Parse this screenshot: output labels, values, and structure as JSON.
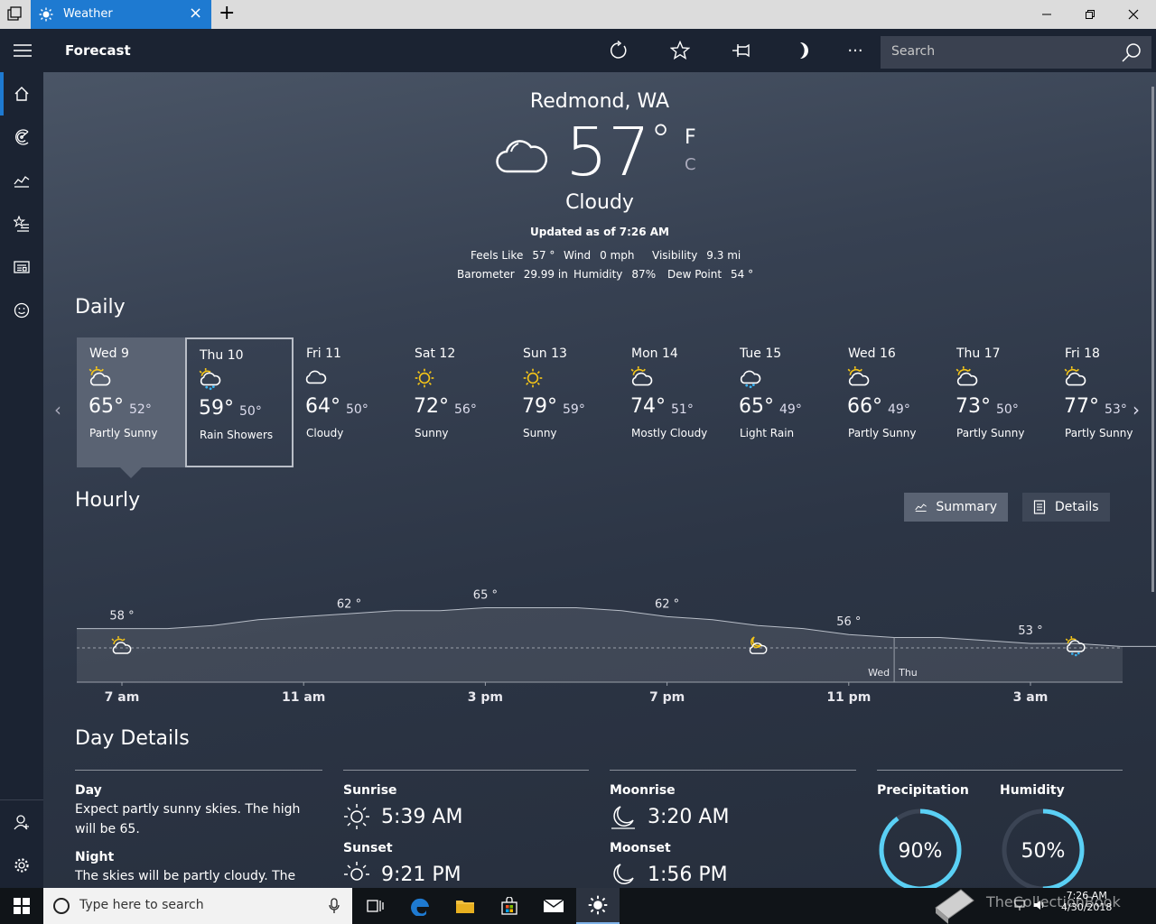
{
  "tab": {
    "title": "Weather"
  },
  "appbar": {
    "title": "Forecast",
    "search_placeholder": "Search"
  },
  "current": {
    "location": "Redmond, WA",
    "temp": "57",
    "degree": "°",
    "unit_f": "F",
    "unit_c": "C",
    "condition": "Cloudy",
    "updated": "Updated as of 7:26 AM",
    "stats": [
      {
        "label": "Feels Like",
        "value": "57 °"
      },
      {
        "label": "Wind",
        "value": "0 mph"
      },
      {
        "label": "Visibility",
        "value": "9.3 mi"
      },
      {
        "label": "Barometer",
        "value": "29.99 in"
      },
      {
        "label": "Humidity",
        "value": "87%"
      },
      {
        "label": "Dew Point",
        "value": "54 °"
      }
    ]
  },
  "daily": {
    "title": "Daily",
    "days": [
      {
        "name": "Wed 9",
        "hi": "65°",
        "lo": "52°",
        "cond": "Partly Sunny",
        "icon": "partly-sunny-icon"
      },
      {
        "name": "Thu 10",
        "hi": "59°",
        "lo": "50°",
        "cond": "Rain Showers",
        "icon": "rain-showers-icon"
      },
      {
        "name": "Fri 11",
        "hi": "64°",
        "lo": "50°",
        "cond": "Cloudy",
        "icon": "cloud-icon"
      },
      {
        "name": "Sat 12",
        "hi": "72°",
        "lo": "56°",
        "cond": "Sunny",
        "icon": "sun-icon"
      },
      {
        "name": "Sun 13",
        "hi": "79°",
        "lo": "59°",
        "cond": "Sunny",
        "icon": "sun-icon"
      },
      {
        "name": "Mon 14",
        "hi": "74°",
        "lo": "51°",
        "cond": "Mostly Cloudy",
        "icon": "mostly-cloudy-icon"
      },
      {
        "name": "Tue 15",
        "hi": "65°",
        "lo": "49°",
        "cond": "Light Rain",
        "icon": "light-rain-icon"
      },
      {
        "name": "Wed 16",
        "hi": "66°",
        "lo": "49°",
        "cond": "Partly Sunny",
        "icon": "partly-sunny-icon"
      },
      {
        "name": "Thu 17",
        "hi": "73°",
        "lo": "50°",
        "cond": "Partly Sunny",
        "icon": "partly-sunny-icon"
      },
      {
        "name": "Fri 18",
        "hi": "77°",
        "lo": "53°",
        "cond": "Partly Sunny",
        "icon": "partly-sunny-icon"
      }
    ]
  },
  "hourly": {
    "title": "Hourly",
    "summary_label": "Summary",
    "details_label": "Details",
    "day_divider": {
      "left": "Wed",
      "right": "Thu"
    }
  },
  "chart_data": {
    "type": "area",
    "x_labels": [
      "7 am",
      "11 am",
      "3 pm",
      "7 pm",
      "11 pm",
      "3 am"
    ],
    "x_hours": [
      7,
      8,
      9,
      10,
      11,
      12,
      13,
      14,
      15,
      16,
      17,
      18,
      19,
      20,
      21,
      22,
      23,
      24,
      25,
      26,
      27,
      28,
      29,
      30
    ],
    "values": [
      58,
      58,
      59,
      61,
      62,
      63,
      64,
      64,
      65,
      65,
      65,
      64,
      62,
      61,
      59,
      58,
      56,
      55,
      55,
      54,
      53,
      53,
      52,
      52
    ],
    "labeled_points": [
      {
        "hour": 7,
        "value": 58,
        "label": "58 °"
      },
      {
        "hour": 12,
        "value": 62,
        "label": "62 °"
      },
      {
        "hour": 15,
        "value": 65,
        "label": "65 °"
      },
      {
        "hour": 19,
        "value": 62,
        "label": "62 °"
      },
      {
        "hour": 23,
        "value": 56,
        "label": "56 °"
      },
      {
        "hour": 27,
        "value": 53,
        "label": "53 °"
      }
    ],
    "condition_icons": [
      {
        "hour": 7,
        "icon": "partly-sunny-icon"
      },
      {
        "hour": 21,
        "icon": "partly-cloudy-night-icon"
      },
      {
        "hour": 28,
        "icon": "rain-showers-icon"
      }
    ],
    "ylim": [
      40,
      70
    ]
  },
  "day_details": {
    "title": "Day Details",
    "day_label": "Day",
    "day_text": "Expect partly sunny skies. The high will be 65.",
    "night_label": "Night",
    "night_text": "The skies will be partly cloudy. The low",
    "sunrise_label": "Sunrise",
    "sunrise": "5:39 AM",
    "sunset_label": "Sunset",
    "sunset": "9:21 PM",
    "moonrise_label": "Moonrise",
    "moonrise": "3:20 AM",
    "moonset_label": "Moonset",
    "moonset": "1:56 PM",
    "precip_label": "Precipitation",
    "precip": "90%",
    "precip_value": 0.9,
    "humidity_label": "Humidity",
    "humidity": "50%",
    "humidity_value": 0.5
  },
  "taskbar": {
    "search_placeholder": "Type here to search",
    "time": "7:26 AM",
    "date": "4/30/2018",
    "watermark": "TheCollectionBook"
  },
  "colors": {
    "accent": "#1e7ad1",
    "sun": "#f5c518",
    "rain": "#3ab4f2",
    "ring": "#5ad0f5"
  }
}
